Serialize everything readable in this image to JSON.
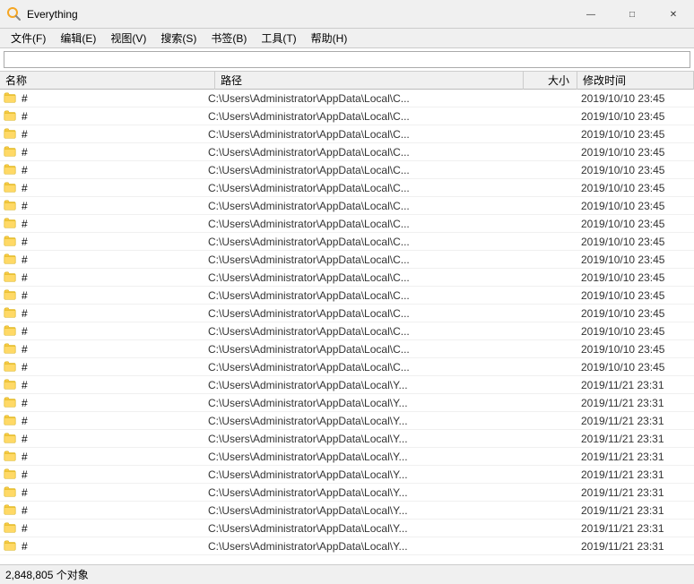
{
  "app": {
    "title": "Everything",
    "icon_color": "#f5a623"
  },
  "window_controls": {
    "minimize": "—",
    "maximize": "□",
    "close": "✕"
  },
  "menu": {
    "items": [
      "文件(F)",
      "编辑(E)",
      "视图(V)",
      "搜索(S)",
      "书签(B)",
      "工具(T)",
      "帮助(H)"
    ]
  },
  "search": {
    "placeholder": "",
    "value": ""
  },
  "columns": {
    "name": "名称",
    "path": "路径",
    "size": "大小",
    "modified": "修改时间"
  },
  "files": [
    {
      "name": "#",
      "path": "C:\\Users\\Administrator\\AppData\\Local\\C...",
      "size": "",
      "modified": "2019/10/10 23:45"
    },
    {
      "name": "#",
      "path": "C:\\Users\\Administrator\\AppData\\Local\\C...",
      "size": "",
      "modified": "2019/10/10 23:45"
    },
    {
      "name": "#",
      "path": "C:\\Users\\Administrator\\AppData\\Local\\C...",
      "size": "",
      "modified": "2019/10/10 23:45"
    },
    {
      "name": "#",
      "path": "C:\\Users\\Administrator\\AppData\\Local\\C...",
      "size": "",
      "modified": "2019/10/10 23:45"
    },
    {
      "name": "#",
      "path": "C:\\Users\\Administrator\\AppData\\Local\\C...",
      "size": "",
      "modified": "2019/10/10 23:45"
    },
    {
      "name": "#",
      "path": "C:\\Users\\Administrator\\AppData\\Local\\C...",
      "size": "",
      "modified": "2019/10/10 23:45"
    },
    {
      "name": "#",
      "path": "C:\\Users\\Administrator\\AppData\\Local\\C...",
      "size": "",
      "modified": "2019/10/10 23:45"
    },
    {
      "name": "#",
      "path": "C:\\Users\\Administrator\\AppData\\Local\\C...",
      "size": "",
      "modified": "2019/10/10 23:45"
    },
    {
      "name": "#",
      "path": "C:\\Users\\Administrator\\AppData\\Local\\C...",
      "size": "",
      "modified": "2019/10/10 23:45"
    },
    {
      "name": "#",
      "path": "C:\\Users\\Administrator\\AppData\\Local\\C...",
      "size": "",
      "modified": "2019/10/10 23:45"
    },
    {
      "name": "#",
      "path": "C:\\Users\\Administrator\\AppData\\Local\\C...",
      "size": "",
      "modified": "2019/10/10 23:45"
    },
    {
      "name": "#",
      "path": "C:\\Users\\Administrator\\AppData\\Local\\C...",
      "size": "",
      "modified": "2019/10/10 23:45"
    },
    {
      "name": "#",
      "path": "C:\\Users\\Administrator\\AppData\\Local\\C...",
      "size": "",
      "modified": "2019/10/10 23:45"
    },
    {
      "name": "#",
      "path": "C:\\Users\\Administrator\\AppData\\Local\\C...",
      "size": "",
      "modified": "2019/10/10 23:45"
    },
    {
      "name": "#",
      "path": "C:\\Users\\Administrator\\AppData\\Local\\C...",
      "size": "",
      "modified": "2019/10/10 23:45"
    },
    {
      "name": "#",
      "path": "C:\\Users\\Administrator\\AppData\\Local\\C...",
      "size": "",
      "modified": "2019/10/10 23:45"
    },
    {
      "name": "#",
      "path": "C:\\Users\\Administrator\\AppData\\Local\\Y...",
      "size": "",
      "modified": "2019/11/21 23:31"
    },
    {
      "name": "#",
      "path": "C:\\Users\\Administrator\\AppData\\Local\\Y...",
      "size": "",
      "modified": "2019/11/21 23:31"
    },
    {
      "name": "#",
      "path": "C:\\Users\\Administrator\\AppData\\Local\\Y...",
      "size": "",
      "modified": "2019/11/21 23:31"
    },
    {
      "name": "#",
      "path": "C:\\Users\\Administrator\\AppData\\Local\\Y...",
      "size": "",
      "modified": "2019/11/21 23:31"
    },
    {
      "name": "#",
      "path": "C:\\Users\\Administrator\\AppData\\Local\\Y...",
      "size": "",
      "modified": "2019/11/21 23:31"
    },
    {
      "name": "#",
      "path": "C:\\Users\\Administrator\\AppData\\Local\\Y...",
      "size": "",
      "modified": "2019/11/21 23:31"
    },
    {
      "name": "#",
      "path": "C:\\Users\\Administrator\\AppData\\Local\\Y...",
      "size": "",
      "modified": "2019/11/21 23:31"
    },
    {
      "name": "#",
      "path": "C:\\Users\\Administrator\\AppData\\Local\\Y...",
      "size": "",
      "modified": "2019/11/21 23:31"
    },
    {
      "name": "#",
      "path": "C:\\Users\\Administrator\\AppData\\Local\\Y...",
      "size": "",
      "modified": "2019/11/21 23:31"
    },
    {
      "name": "#",
      "path": "C:\\Users\\Administrator\\AppData\\Local\\Y...",
      "size": "",
      "modified": "2019/11/21 23:31"
    }
  ],
  "status": {
    "text": "2,848,805 个对象"
  }
}
